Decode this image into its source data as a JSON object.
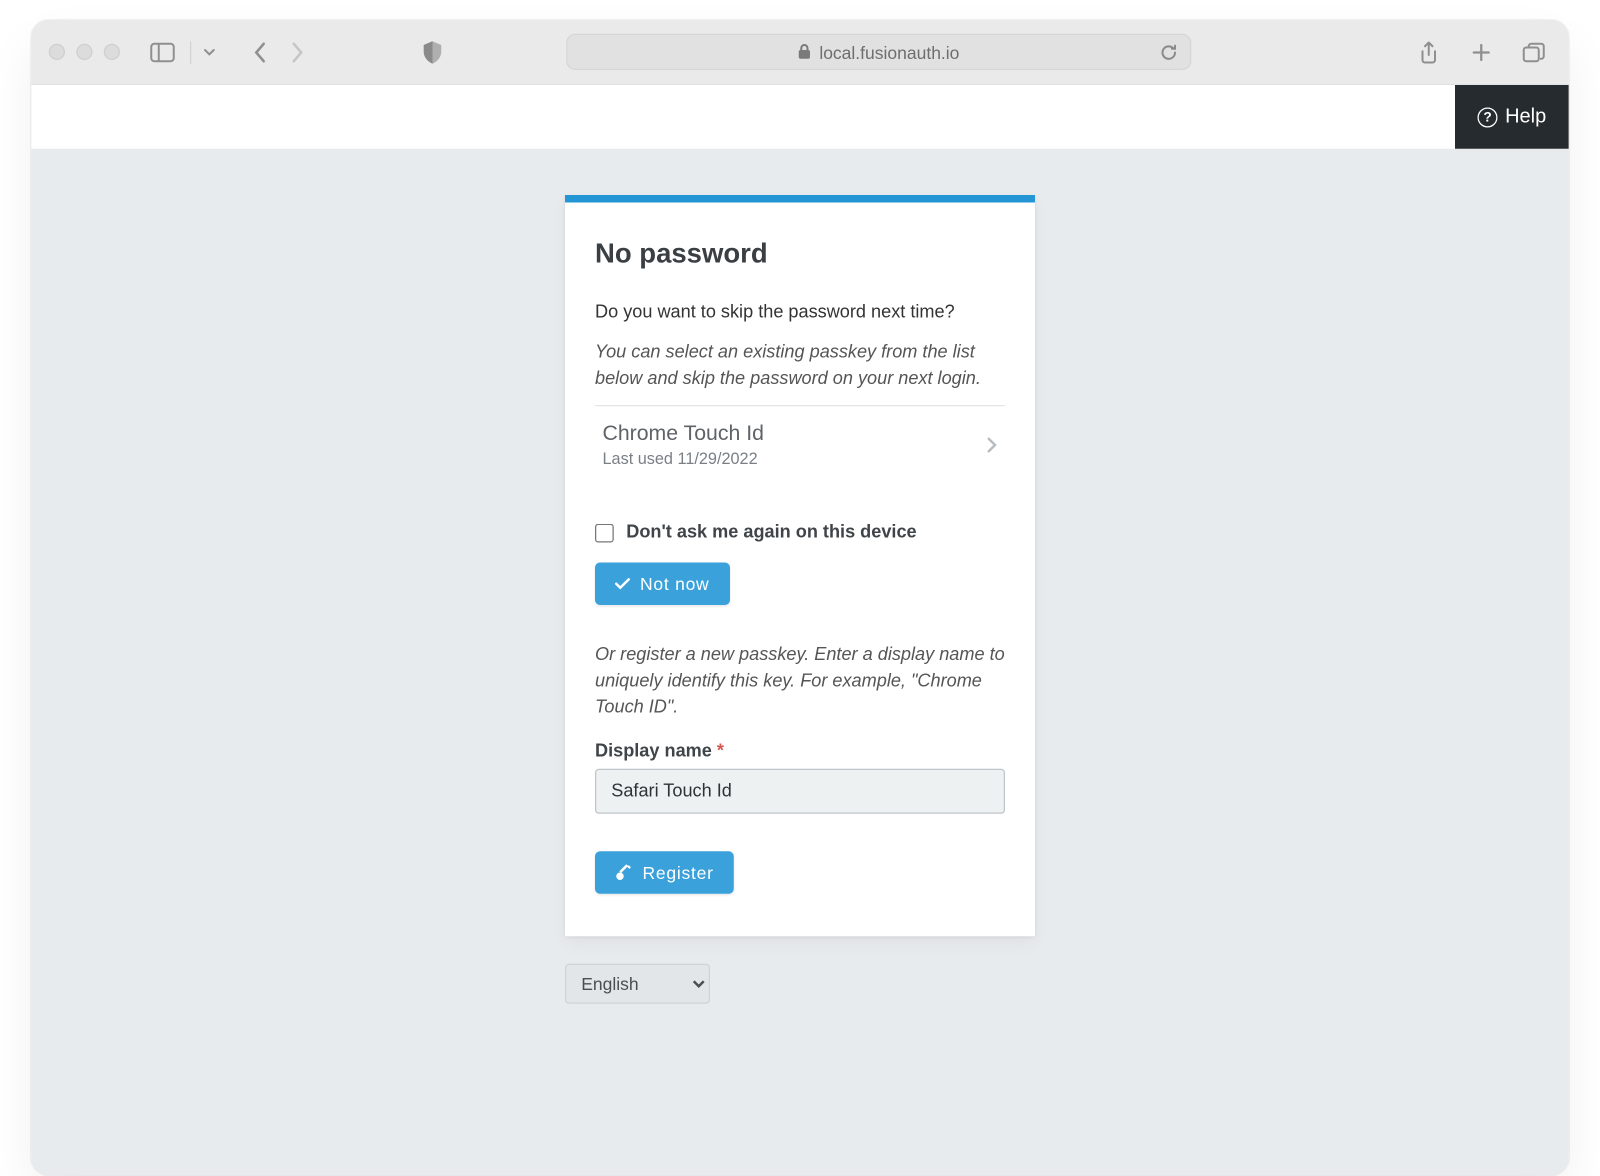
{
  "browser": {
    "url": "local.fusionauth.io"
  },
  "appbar": {
    "help_label": "Help"
  },
  "card": {
    "title": "No password",
    "prompt": "Do you want to skip the password next time?",
    "hint1": "You can select an existing passkey from the list below and skip the password on your next login.",
    "passkey": {
      "name": "Chrome Touch Id",
      "last_used": "Last used 11/29/2022"
    },
    "dont_ask_label": "Don't ask me again on this device",
    "not_now_label": "Not now",
    "hint2": "Or register a new passkey. Enter a display name to uniquely identify this key. For example, \"Chrome Touch ID\".",
    "display_name_label": "Display name",
    "display_name_value": "Safari Touch Id",
    "register_label": "Register"
  },
  "lang": {
    "selected": "English"
  }
}
